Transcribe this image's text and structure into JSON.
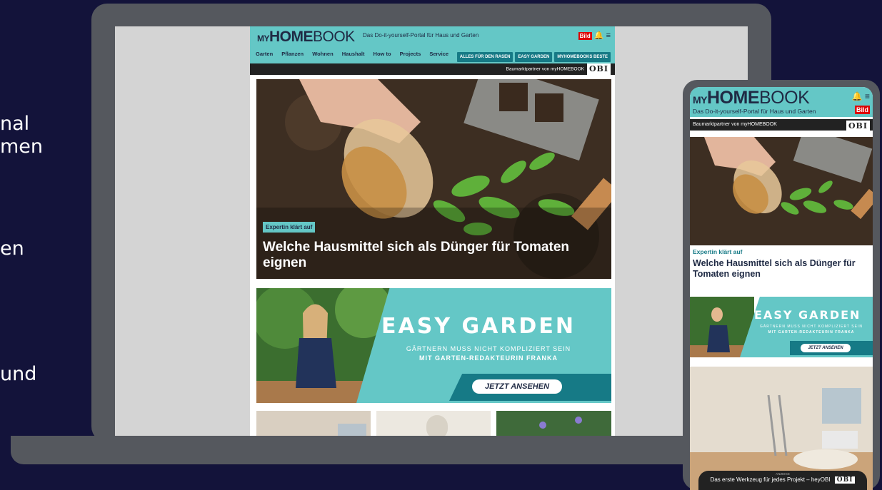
{
  "left_text": [
    "nal",
    "men",
    "en",
    "und"
  ],
  "desktop": {
    "logo": {
      "my": "MY",
      "home": "HOME",
      "book": "BOOK"
    },
    "tagline": "Das Do-it-yourself-Portal für Haus und Garten",
    "header_icons": "🔔 ≡",
    "bild_logo": "Bild",
    "nav": [
      "Garten",
      "Pflanzen",
      "Wohnen",
      "Haushalt",
      "How to",
      "Projects",
      "Service"
    ],
    "pills": [
      "ALLES FÜR DEN RASEN",
      "EASY GARDEN",
      "MYHOMEBOOKS BESTE"
    ],
    "partner_text": "Baumarktpartner von myHOMEBOOK",
    "obi": "OBI",
    "hero": {
      "badge": "Expertin klärt auf",
      "title_line1": "Welche Hausmittel sich als Dünger für Tomaten",
      "title_line2": "eignen"
    },
    "promo": {
      "title": "EASY GARDEN",
      "subtitle_line1": "GÄRTNERN MUSS NICHT KOMPLIZIERT SEIN",
      "subtitle_line2": "MIT GARTEN-REDAKTEURIN FRANKA",
      "cta": "JETZT ANSEHEN"
    }
  },
  "mobile": {
    "logo": {
      "my": "MY",
      "home": "HOME",
      "book": "BOOK"
    },
    "tagline": "Das Do-it-yourself-Portal für Haus und Garten",
    "header_icons": "🔔 ≡",
    "bild_logo": "Bild",
    "partner_text": "Baumarktpartner von myHOMEBOOK",
    "obi": "OBI",
    "hero": {
      "badge": "Expertin klärt auf",
      "title": "Welche Hausmittel sich als Dünger für Tomaten eignen"
    },
    "promo": {
      "title": "EASY GARDEN",
      "subtitle_line1": "GÄRTNERN MUSS NICHT KOMPLIZIERT SEIN",
      "subtitle_line2": "MIT GARTEN-REDAKTEURIN FRANKA",
      "cta": "JETZT ANSEHEN"
    },
    "ad": {
      "label": "ANZEIGE",
      "text": "Das erste Werkzeug für jedes Projekt – heyOBI",
      "obi": "OBI"
    }
  },
  "colors": {
    "background": "#13133a",
    "device": "#55585e",
    "teal": "#64c7c6",
    "dark_teal": "#167a86",
    "navy": "#1f2a44"
  }
}
